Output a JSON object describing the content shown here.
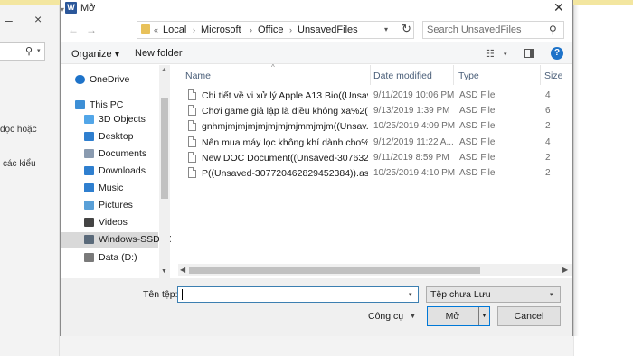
{
  "background_app": {
    "minimize_glyph": "–",
    "close_glyph": "×",
    "search_glyph": "⚲",
    "search_dropdown_glyph": "▾",
    "text_line_1": "đọc hoặc",
    "text_line_2": "các kiểu"
  },
  "dialog": {
    "title": "Mở",
    "app_icon_letter": "W",
    "close_glyph": "✕"
  },
  "navigation": {
    "back_glyph": "←",
    "forward_glyph": "→",
    "recent_glyph": "▾",
    "up_glyph": "↑"
  },
  "address_bar": {
    "overflow_glyph": "«",
    "separator_glyph": "›",
    "segments": [
      "Local",
      "Microsoft",
      "Office",
      "UnsavedFiles"
    ],
    "dropdown_glyph": "▾",
    "refresh_glyph": "↻"
  },
  "search": {
    "placeholder": "Search UnsavedFiles",
    "icon_glyph": "⚲"
  },
  "toolbar": {
    "organize_label": "Organize ▾",
    "new_folder_label": "New folder",
    "view_glyph": "☷",
    "view_dropdown_glyph": "▾",
    "help_glyph": "?"
  },
  "nav_pane": {
    "items": [
      {
        "label": "OneDrive",
        "icon": "cloud-icon",
        "color": "#1e73c9"
      },
      {
        "label": "This PC",
        "icon": "computer-icon",
        "color": "#3d8fd6"
      },
      {
        "label": "3D Objects",
        "icon": "cube-icon",
        "color": "#52a6e8"
      },
      {
        "label": "Desktop",
        "icon": "desktop-icon",
        "color": "#2f7fcf"
      },
      {
        "label": "Documents",
        "icon": "documents-icon",
        "color": "#8a9bb0"
      },
      {
        "label": "Downloads",
        "icon": "download-icon",
        "color": "#2f7fcf"
      },
      {
        "label": "Music",
        "icon": "music-icon",
        "color": "#2f7fcf"
      },
      {
        "label": "Pictures",
        "icon": "pictures-icon",
        "color": "#5aa0d8"
      },
      {
        "label": "Videos",
        "icon": "videos-icon",
        "color": "#444444"
      },
      {
        "label": "Windows-SSD (C",
        "icon": "drive-icon",
        "color": "#5a6a7a",
        "selected": true
      },
      {
        "label": "Data (D:)",
        "icon": "drive-icon",
        "color": "#7a7a7a"
      }
    ],
    "scroll_up_glyph": "▲",
    "scroll_down_glyph": "▼"
  },
  "file_list": {
    "columns": {
      "name": "Name",
      "date_modified": "Date modified",
      "type": "Type",
      "size": "Size"
    },
    "sort_glyph": "^",
    "rows": [
      {
        "name": "Chi tiết về vi xử lý Apple A13 Bio((Unsave...",
        "date": "9/11/2019 10:06 PM",
        "type": "ASD File",
        "size": "4"
      },
      {
        "name": "Chơi game giả lập là điều không xa%2((...",
        "date": "9/13/2019 1:39 PM",
        "type": "ASD File",
        "size": "6"
      },
      {
        "name": "gnhmjmjmjmjmjmjmjmjmmjmjm((Unsav...",
        "date": "10/25/2019 4:09 PM",
        "type": "ASD File",
        "size": "2"
      },
      {
        "name": "Nên mua máy lọc không khí dành cho%2...",
        "date": "9/12/2019 11:22 A...",
        "type": "ASD File",
        "size": "4"
      },
      {
        "name": "New DOC Document((Unsaved-3076323...",
        "date": "9/11/2019 8:59 PM",
        "type": "ASD File",
        "size": "2"
      },
      {
        "name": "P((Unsaved-307720462829452384)).asd",
        "date": "10/25/2019 4:10 PM",
        "type": "ASD File",
        "size": "2"
      }
    ],
    "hscroll_left_glyph": "◀",
    "hscroll_right_glyph": "▶"
  },
  "footer": {
    "filename_label": "Tên tệp:",
    "filename_value": "",
    "filename_dropdown_glyph": "▾",
    "filetype_value": "Tệp chưa Lưu",
    "filetype_dropdown_glyph": "▾",
    "tools_label": "Công cụ",
    "tools_dropdown_glyph": "▼",
    "open_label": "Mở",
    "open_dropdown_glyph": "▼",
    "cancel_label": "Cancel"
  }
}
